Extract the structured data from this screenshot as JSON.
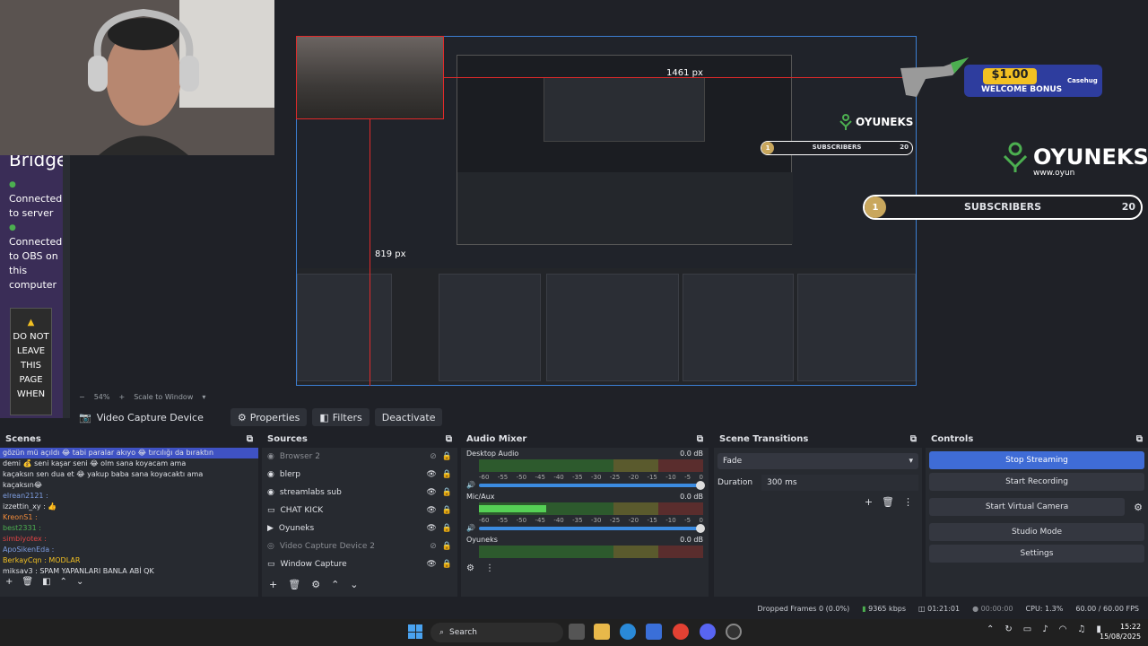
{
  "preview": {
    "bridge_title": "Bridge",
    "status_1": "Connected to server",
    "status_2": "Connected to OBS on this computer",
    "warning": "DO NOT LEAVE THIS PAGE WHEN",
    "measure_1": "1461 px",
    "measure_2": "819 px",
    "zoom": "54%",
    "scale_mode": "Scale to Window"
  },
  "overlay": {
    "brand": "OYUNEKS",
    "brand_sub": "www.oyun",
    "subscribers_label": "SUBSCRIBERS",
    "subscribers_count": "20",
    "subscribers_rank": "1",
    "bonus_amount": "$1.00",
    "bonus_text": "WELCOME BONUS",
    "bonus_brand": "Casehug"
  },
  "toolbar": {
    "source_name": "Video Capture Device",
    "properties": "Properties",
    "filters": "Filters",
    "deactivate": "Deactivate"
  },
  "scenes": {
    "title": "Scenes",
    "chat": [
      "gözün mü açıldı 😂 tabi paralar akıyo 😂 tırcılığı da bıraktın",
      "demi 💰 seni kaşar seni 😂 olm sana koyacam ama",
      "kaçaksın sen dua et 😂 yakup baba sana koyacaktı ama",
      "kaçaksın😂",
      "elrean2121 :",
      "izzettin_xy : 👍",
      "KreonS1 :",
      "best2331 :",
      "simbiyotex :",
      "ApoSikenEda :",
      "BerkayCqn : MODLAR",
      "miksav3 : SPAM YAPANLARI BANLA ABİ QK"
    ]
  },
  "sources": {
    "title": "Sources",
    "items": [
      {
        "label": "Browser 2",
        "dim": true
      },
      {
        "label": "blerp",
        "dim": false
      },
      {
        "label": "streamlabs sub",
        "dim": false
      },
      {
        "label": "CHAT KICK",
        "dim": false
      },
      {
        "label": "Oyuneks",
        "dim": false
      },
      {
        "label": "Video Capture Device 2",
        "dim": true
      },
      {
        "label": "Window Capture",
        "dim": false
      }
    ]
  },
  "mixer": {
    "title": "Audio Mixer",
    "tracks": [
      {
        "name": "Desktop Audio",
        "db": "0.0 dB",
        "level": 0
      },
      {
        "name": "Mic/Aux",
        "db": "0.0 dB",
        "level": 0.3
      },
      {
        "name": "Oyuneks",
        "db": "0.0 dB",
        "level": 0
      }
    ],
    "scale": [
      "-60",
      "-55",
      "-50",
      "-45",
      "-40",
      "-35",
      "-30",
      "-25",
      "-20",
      "-15",
      "-10",
      "-5",
      "0"
    ]
  },
  "transitions": {
    "title": "Scene Transitions",
    "selected": "Fade",
    "duration_label": "Duration",
    "duration_value": "300 ms"
  },
  "controls": {
    "title": "Controls",
    "stop_streaming": "Stop Streaming",
    "start_recording": "Start Recording",
    "start_virtual_camera": "Start Virtual Camera",
    "studio_mode": "Studio Mode",
    "settings": "Settings"
  },
  "status": {
    "dropped": "Dropped Frames 0 (0.0%)",
    "bitrate": "9365 kbps",
    "stream_time": "01:21:01",
    "rec_time": "00:00:00",
    "cpu": "CPU: 1.3%",
    "fps": "60.00 / 60.00 FPS"
  },
  "taskbar": {
    "search": "Search",
    "time": "15:22",
    "date": "15/08/2025"
  }
}
